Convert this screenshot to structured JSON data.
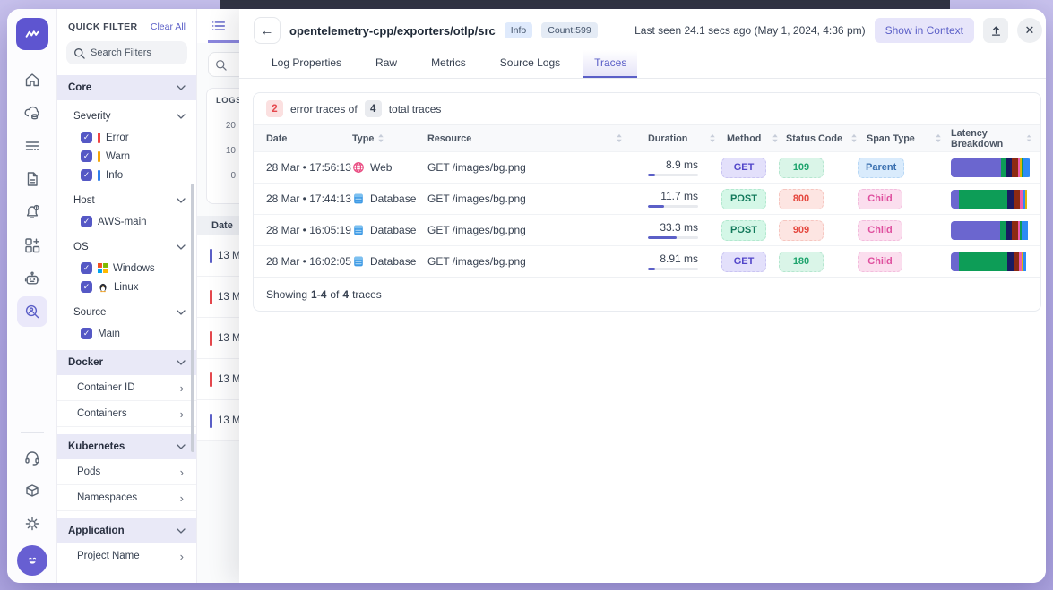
{
  "quick_filter": {
    "title": "QUICK FILTER",
    "clear_all": "Clear All",
    "search_placeholder": "Search Filters",
    "core_label": "Core",
    "sections": [
      {
        "label": "Severity",
        "items": [
          {
            "label": "Error",
            "bar": "#ef4444"
          },
          {
            "label": "Warn",
            "bar": "#f6a609"
          },
          {
            "label": "Info",
            "bar": "#2f80ed"
          }
        ]
      },
      {
        "label": "Host",
        "items": [
          {
            "label": "AWS-main"
          }
        ]
      },
      {
        "label": "OS",
        "items": [
          {
            "label": "Windows"
          },
          {
            "label": "Linux"
          }
        ]
      },
      {
        "label": "Source",
        "items": [
          {
            "label": "Main"
          }
        ]
      }
    ],
    "link_groups": [
      {
        "label": "Docker",
        "items": [
          "Container ID",
          "Containers"
        ]
      },
      {
        "label": "Kubernetes",
        "items": [
          "Pods",
          "Namespaces"
        ]
      },
      {
        "label": "Application",
        "items": [
          "Project Name"
        ]
      }
    ]
  },
  "logs_panel": {
    "title": "LOGS",
    "y_ticks": [
      "20",
      "10",
      "0"
    ],
    "date_header": "Date",
    "rows": [
      {
        "label": "13 M",
        "color": "#5b5fc7"
      },
      {
        "label": "13 M",
        "color": "#e5484d"
      },
      {
        "label": "13 M",
        "color": "#e5484d"
      },
      {
        "label": "13 M",
        "color": "#e5484d"
      },
      {
        "label": "13 M",
        "color": "#5b5fc7"
      }
    ]
  },
  "overlay": {
    "title": "opentelemetry-cpp/exporters/otlp/src",
    "info_badge": "Info",
    "count_badge": "Count:599",
    "last_seen": "Last seen 24.1 secs ago (May 1, 2024, 4:36 pm)",
    "show_in_context": "Show in Context",
    "tabs": [
      {
        "label": "Log Properties"
      },
      {
        "label": "Raw"
      },
      {
        "label": "Metrics"
      },
      {
        "label": "Source Logs"
      },
      {
        "label": "Traces"
      }
    ],
    "summary": {
      "error_count": "2",
      "error_label": "error traces of",
      "total_count": "4",
      "total_label": "total traces"
    },
    "table": {
      "columns": [
        "Date",
        "Type",
        "Resource",
        "Duration",
        "Method",
        "Status Code",
        "Span Type",
        "Latency Breakdown"
      ],
      "rows": [
        {
          "date": "28 Mar • 17:56:13",
          "type": "Web",
          "resource": "GET /images/bg.png",
          "duration": "8.9 ms",
          "duration_pct": "15%",
          "method": {
            "label": "GET",
            "bg": "#e3e0fb",
            "fg": "#5145c9",
            "bd": "#c9c4f2"
          },
          "status": {
            "label": "109",
            "bg": "#daf5e8",
            "fg": "#1ea46d",
            "bd": "#b5e6cf"
          },
          "span": {
            "label": "Parent",
            "bg": "#d9ebfc",
            "fg": "#3a70b0",
            "bd": "#b7d7f5"
          },
          "latency": [
            {
              "c": "#6b66cf",
              "w": "62%"
            },
            {
              "c": "#0d9d57",
              "w": "7%"
            },
            {
              "c": "#191b62",
              "w": "7%"
            },
            {
              "c": "#8c2a12",
              "w": "7%"
            },
            {
              "c": "#ef5baa",
              "w": "3%"
            },
            {
              "c": "#dfb40a",
              "w": "2%"
            },
            {
              "c": "#0d9d57",
              "w": "2%"
            },
            {
              "c": "#2e8af5",
              "w": "8%"
            }
          ]
        },
        {
          "date": "28 Mar • 17:44:13",
          "type": "Database",
          "resource": "GET /images/bg.png",
          "duration": "11.7 ms",
          "duration_pct": "33%",
          "method": {
            "label": "POST",
            "bg": "#d4f7e7",
            "fg": "#13795b",
            "bd": "#b2e8cf"
          },
          "status": {
            "label": "800",
            "bg": "#fde5e2",
            "fg": "#e5483f",
            "bd": "#f6c6c0"
          },
          "span": {
            "label": "Child",
            "bg": "#fbdeee",
            "fg": "#df4f9e",
            "bd": "#f3bddd"
          },
          "latency": [
            {
              "c": "#6b66cf",
              "w": "10%"
            },
            {
              "c": "#0d9d57",
              "w": "60%"
            },
            {
              "c": "#191b62",
              "w": "8%"
            },
            {
              "c": "#8c2a12",
              "w": "8%"
            },
            {
              "c": "#ef5baa",
              "w": "3%"
            },
            {
              "c": "#2e8af5",
              "w": "3%"
            },
            {
              "c": "#dfb40a",
              "w": "2%"
            }
          ]
        },
        {
          "date": "28 Mar • 16:05:19",
          "type": "Database",
          "resource": "GET /images/bg.png",
          "duration": "33.3 ms",
          "duration_pct": "58%",
          "method": {
            "label": "POST",
            "bg": "#d4f7e7",
            "fg": "#13795b",
            "bd": "#b2e8cf"
          },
          "status": {
            "label": "909",
            "bg": "#fde5e2",
            "fg": "#e5483f",
            "bd": "#f6c6c0"
          },
          "span": {
            "label": "Child",
            "bg": "#fbdeee",
            "fg": "#df4f9e",
            "bd": "#f3bddd"
          },
          "latency": [
            {
              "c": "#6b66cf",
              "w": "61%"
            },
            {
              "c": "#0d9d57",
              "w": "7%"
            },
            {
              "c": "#191b62",
              "w": "8%"
            },
            {
              "c": "#8c2a12",
              "w": "7%"
            },
            {
              "c": "#ef5baa",
              "w": "3%"
            },
            {
              "c": "#0d9d57",
              "w": "2%"
            },
            {
              "c": "#2e8af5",
              "w": "8%"
            }
          ]
        },
        {
          "date": "28 Mar • 16:02:05",
          "type": "Database",
          "resource": "GET /images/bg.png",
          "duration": "8.91 ms",
          "duration_pct": "15%",
          "method": {
            "label": "GET",
            "bg": "#e3e0fb",
            "fg": "#5145c9",
            "bd": "#c9c4f2"
          },
          "status": {
            "label": "180",
            "bg": "#daf5e8",
            "fg": "#1ea46d",
            "bd": "#b5e6cf"
          },
          "span": {
            "label": "Child",
            "bg": "#fbdeee",
            "fg": "#df4f9e",
            "bd": "#f3bddd"
          },
          "latency": [
            {
              "c": "#6b66cf",
              "w": "10%"
            },
            {
              "c": "#0d9d57",
              "w": "60%"
            },
            {
              "c": "#191b62",
              "w": "8%"
            },
            {
              "c": "#8c2a12",
              "w": "7%"
            },
            {
              "c": "#ef5baa",
              "w": "3%"
            },
            {
              "c": "#dfb40a",
              "w": "2%"
            },
            {
              "c": "#2e8af5",
              "w": "3%"
            }
          ]
        }
      ]
    },
    "footer": {
      "prefix": "Showing",
      "range": "1-4",
      "middle": "of",
      "total": "4",
      "suffix": "traces"
    }
  }
}
